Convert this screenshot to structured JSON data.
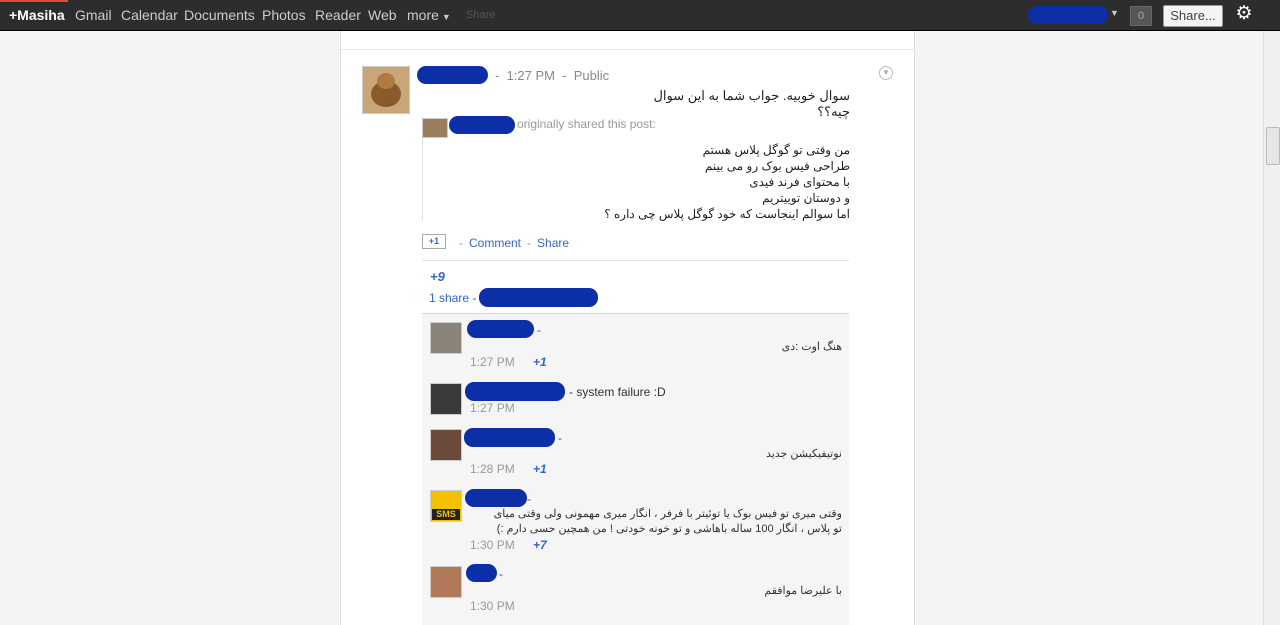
{
  "topbar": {
    "brand": "+Masiha",
    "items": [
      "Gmail",
      "Calendar",
      "Documents",
      "Photos",
      "Reader",
      "Web",
      "more"
    ],
    "notifications": "0",
    "share_label": "Share...",
    "hidden_share": "Share"
  },
  "post": {
    "time": "1:27 PM",
    "visibility": "Public",
    "text": "سوال خوبیه. جواب شما به این سوال چیه؟؟",
    "shared_label": "originally shared this post:",
    "shared_lines": [
      "من وقتی تو گوگل پلاس هستم",
      "طراحی فیس بوک رو می بینم",
      "با محتوای فرند فیدی",
      "و دوستان توییتریم",
      "اما سوالم اینجاست که خود گوگل پلاس چی داره ؟"
    ],
    "plusone_label": "+1",
    "comment_label": "Comment",
    "share_label": "Share",
    "plus_count": "+9",
    "share_count": "1 share"
  },
  "comments": [
    {
      "text": "هنگ اوت :دی",
      "time": "1:27 PM",
      "plus": "+1"
    },
    {
      "text": "- system failure :D",
      "time": "1:27 PM",
      "plus": ""
    },
    {
      "text": "نوتیفیکیشن جدید",
      "time": "1:28 PM",
      "plus": "+1"
    },
    {
      "text": "وقتی میری تو فیس بوک یا توئیتر با فرفر ، انگار میری مهمونی ولی وقتی میای تو پلاس ، انگار 100 ساله باهاشی و تو خونه خودتی ! من همچین حسی دارم :)",
      "time": "1:30 PM",
      "plus": "+7"
    },
    {
      "text": "با علیرضا موافقم",
      "time": "1:30 PM",
      "plus": ""
    }
  ],
  "colors": {
    "redaction": "#0c2fa8",
    "link": "#3366cc",
    "topbar": "#2d2d2d"
  }
}
